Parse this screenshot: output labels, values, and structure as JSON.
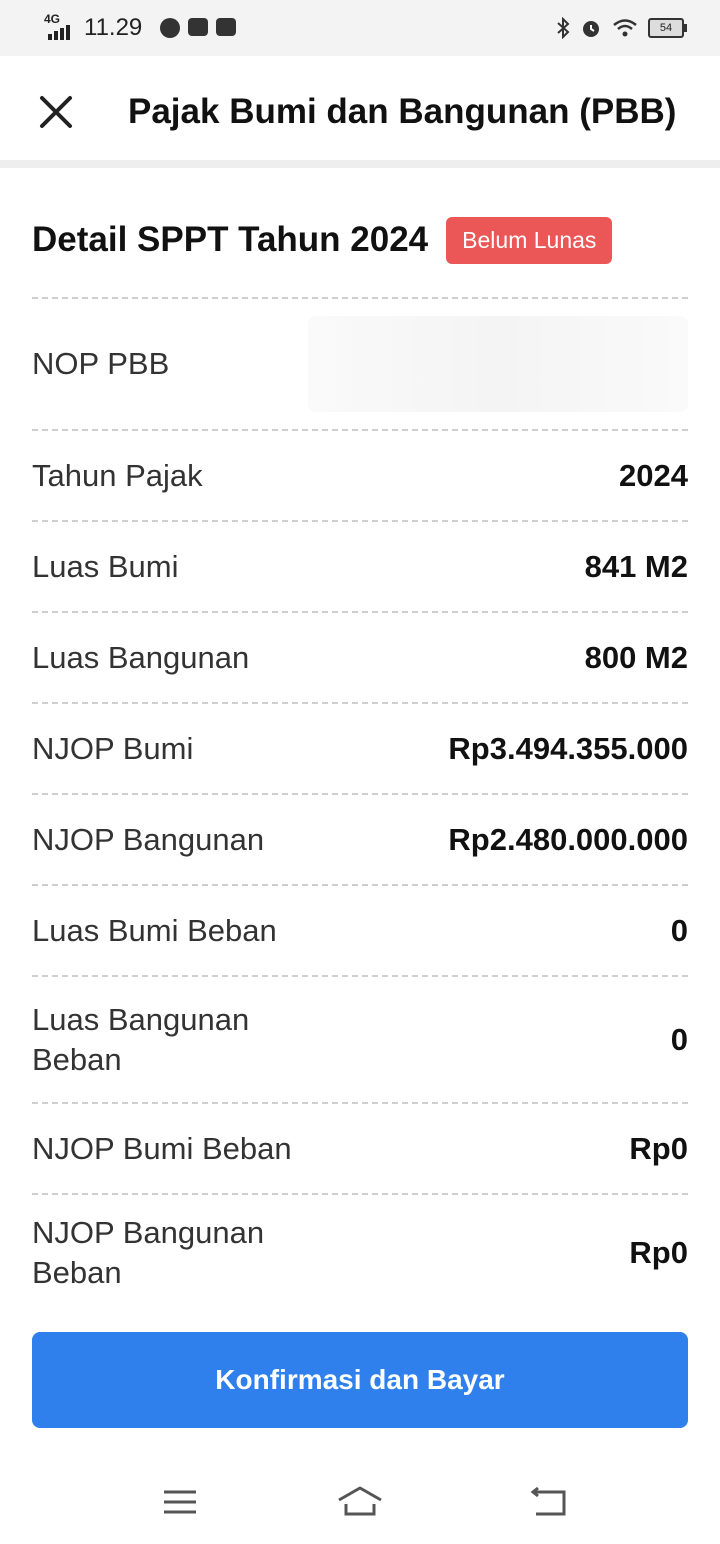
{
  "status_bar": {
    "network": "4G",
    "time": "11.29",
    "battery": "54",
    "icons": [
      "signal-icon",
      "timer-icon",
      "shopping-bag-icon",
      "mail-icon",
      "bluetooth-icon",
      "alarm-icon",
      "wifi-icon",
      "battery-icon"
    ]
  },
  "header": {
    "title": "Pajak Bumi dan Bangunan (PBB)",
    "close_icon": "close-icon"
  },
  "section": {
    "title": "Detail SPPT Tahun 2024",
    "badge": "Belum Lunas",
    "badge_color": "#eb5757"
  },
  "details": [
    {
      "label": "NOP PBB",
      "value": ""
    },
    {
      "label": "Tahun Pajak",
      "value": "2024"
    },
    {
      "label": "Luas Bumi",
      "value": "841 M2"
    },
    {
      "label": "Luas Bangunan",
      "value": "800 M2"
    },
    {
      "label": "NJOP Bumi",
      "value": "Rp3.494.355.000"
    },
    {
      "label": "NJOP Bangunan",
      "value": "Rp2.480.000.000"
    },
    {
      "label": "Luas Bumi Beban",
      "value": "0"
    },
    {
      "label": "Luas Bangunan Beban",
      "value": "0"
    },
    {
      "label": "NJOP Bumi Beban",
      "value": "Rp0"
    },
    {
      "label": "NJOP Bangunan Beban",
      "value": "Rp0"
    }
  ],
  "action": {
    "pay_label": "Konfirmasi dan Bayar",
    "color": "#2f80ed"
  },
  "nav": {
    "icons": [
      "menu-icon",
      "home-icon",
      "back-icon"
    ]
  }
}
